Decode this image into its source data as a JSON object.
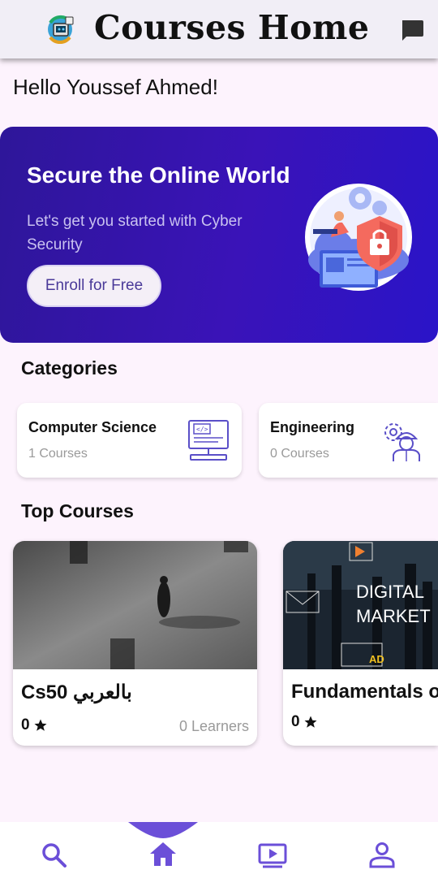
{
  "app_bar": {
    "title": "Courses Home",
    "logo_icon": "robot-logo-icon",
    "chat_icon": "chat-bubble-icon"
  },
  "greeting": "Hello Youssef Ahmed!",
  "hero": {
    "title": "Secure the Online World",
    "subtitle": "Let's get you started with Cyber Security",
    "button_label": "Enroll for Free",
    "illustration_icon": "cyber-security-illustration"
  },
  "categories": {
    "heading": "Categories",
    "items": [
      {
        "name": "Computer Science",
        "count": "1 Courses",
        "icon": "computer-code-icon"
      },
      {
        "name": "Engineering",
        "count": "0 Courses",
        "icon": "engineer-gear-icon"
      }
    ]
  },
  "top_courses": {
    "heading": "Top Courses",
    "items": [
      {
        "title": "Cs50 بالعربي",
        "rating": "0",
        "learners": "0 Learners",
        "image": "person-walking-photo"
      },
      {
        "title": "Fundamentals of",
        "rating": "0",
        "learners": "",
        "image": "digital-marketing-photo",
        "image_text_1": "DIGITAL",
        "image_text_2": "MARKET",
        "image_badge": "AD"
      }
    ]
  },
  "bottom_nav": {
    "items": [
      "search-icon",
      "home-icon",
      "video-play-icon",
      "profile-icon"
    ],
    "active": "home-icon"
  },
  "colors": {
    "accent": "#6b4fd8",
    "hero_start": "#2e1699",
    "hero_end": "#2a14c8",
    "background": "#fdf3fd"
  }
}
